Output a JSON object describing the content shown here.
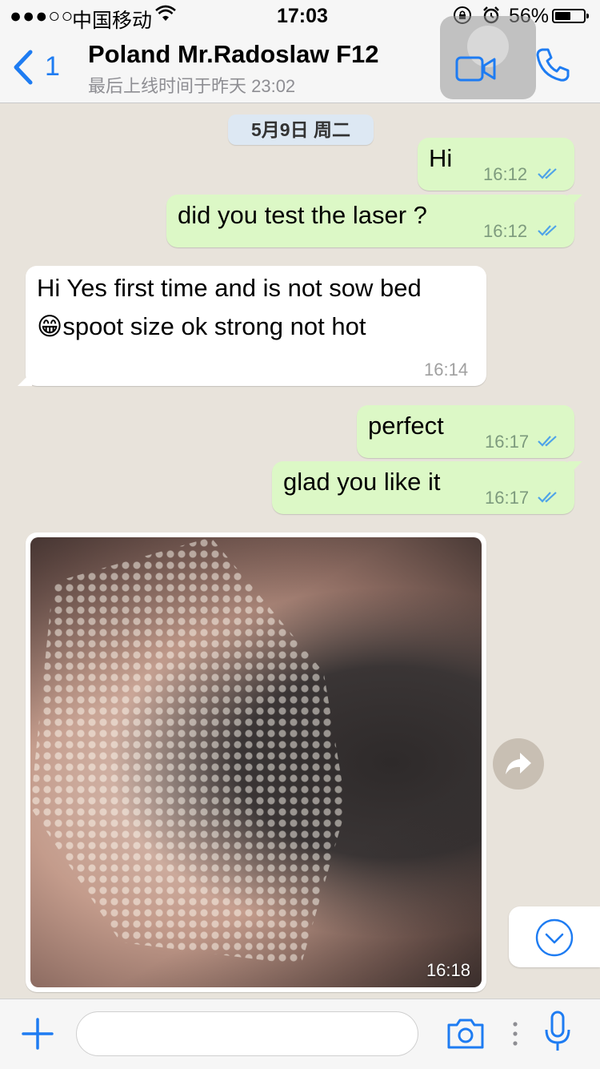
{
  "status_bar": {
    "signal": "●●●○○",
    "carrier": "中国移动",
    "time": "17:03",
    "battery_percent": "56%",
    "battery_level": 0.56
  },
  "header": {
    "back_count": "1",
    "contact_name": "Poland Mr.Radoslaw F12",
    "last_seen": "最后上线时间于昨天 23:02"
  },
  "chat": {
    "date": "5月9日 周二",
    "messages": [
      {
        "direction": "out",
        "text": "Hi",
        "time": "16:12",
        "status": "read"
      },
      {
        "direction": "out",
        "text": "did you test the laser ?",
        "time": "16:12",
        "status": "read"
      },
      {
        "direction": "in",
        "line1": "Hi Yes first time and is not sow bed",
        "emoji": "😁",
        "line2": "spoot size ok strong not hot",
        "time": "16:14"
      },
      {
        "direction": "out",
        "text": "perfect",
        "time": "16:17",
        "status": "read"
      },
      {
        "direction": "out",
        "text": "glad you like it",
        "time": "16:17",
        "status": "read"
      },
      {
        "direction": "in",
        "type": "photo",
        "time": "16:18"
      }
    ]
  },
  "input": {
    "placeholder": ""
  },
  "colors": {
    "accent": "#1e7cf2",
    "outgoing_bubble": "#dcf8c6",
    "incoming_bubble": "#ffffff",
    "read_ticks": "#4fa3e8"
  }
}
